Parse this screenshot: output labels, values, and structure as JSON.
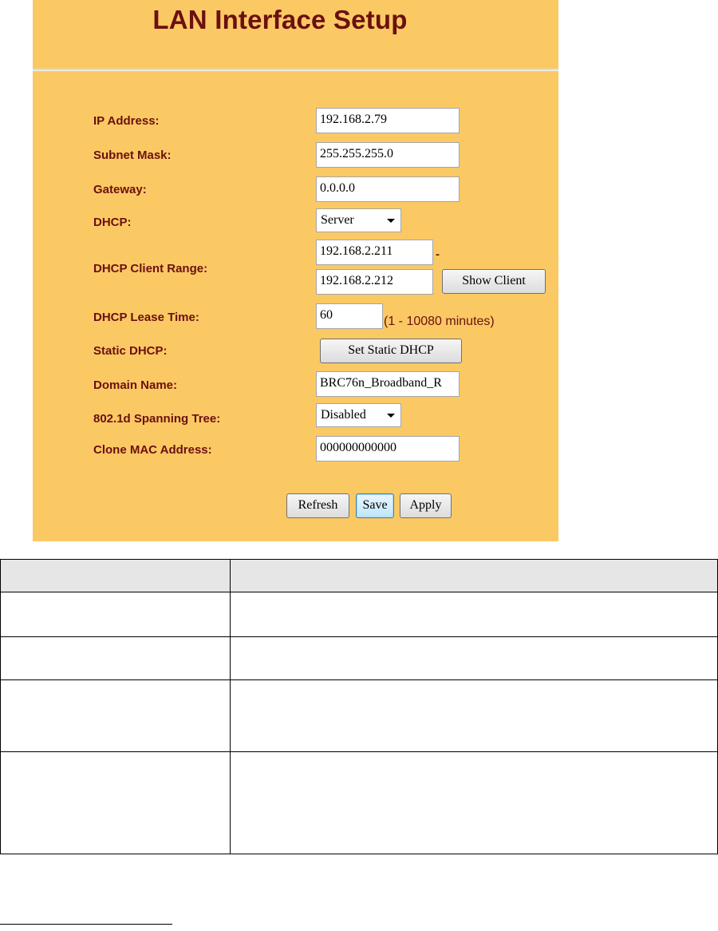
{
  "title": "LAN Interface Setup",
  "fields": {
    "ip_address": {
      "label": "IP Address:",
      "value": "192.168.2.79"
    },
    "subnet_mask": {
      "label": "Subnet Mask:",
      "value": "255.255.255.0"
    },
    "gateway": {
      "label": "Gateway:",
      "value": "0.0.0.0"
    },
    "dhcp": {
      "label": "DHCP:",
      "value": "Server"
    },
    "dhcp_client_range": {
      "label": "DHCP Client Range:",
      "start": "192.168.2.211",
      "end": "192.168.2.212",
      "separator": "-"
    },
    "dhcp_lease_time": {
      "label": "DHCP Lease Time:",
      "value": "60",
      "hint": "(1 - 10080 minutes)"
    },
    "static_dhcp": {
      "label": "Static DHCP:"
    },
    "domain_name": {
      "label": "Domain Name:",
      "value": "BRC76n_Broadband_R"
    },
    "spanning_tree": {
      "label": "802.1d Spanning Tree:",
      "value": "Disabled"
    },
    "clone_mac": {
      "label": "Clone MAC Address:",
      "value": "000000000000"
    }
  },
  "buttons": {
    "show_client": "Show Client",
    "set_static_dhcp": "Set Static DHCP",
    "refresh": "Refresh",
    "save": "Save",
    "apply": "Apply"
  },
  "colors": {
    "panel_background": "#fbc964",
    "label_text": "#6b1010"
  }
}
